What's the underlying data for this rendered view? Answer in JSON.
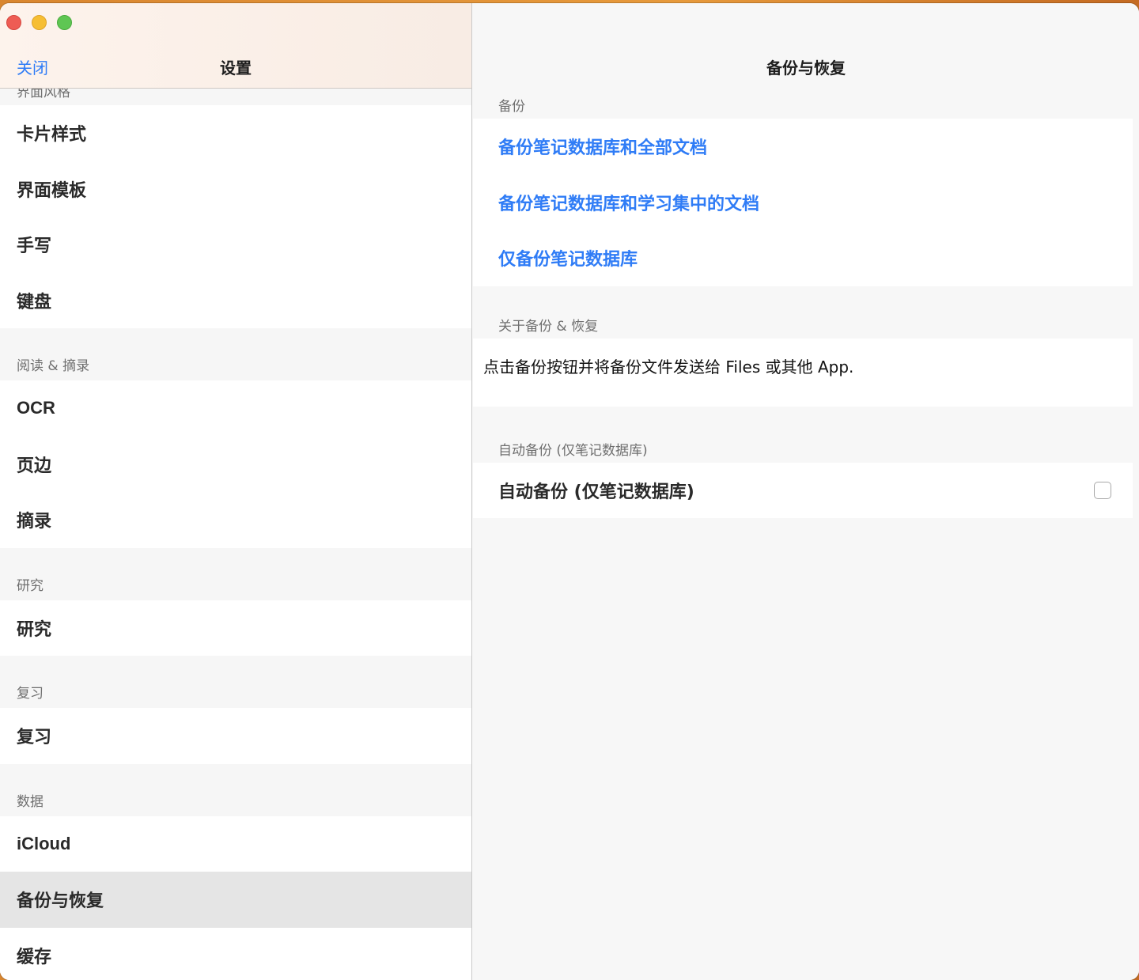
{
  "sidebar": {
    "close_label": "关闭",
    "title": "设置",
    "sections": [
      {
        "label": "界面风格",
        "items": [
          "卡片样式",
          "界面模板",
          "手写",
          "键盘"
        ]
      },
      {
        "label": "阅读 & 摘录",
        "items": [
          "OCR",
          "页边",
          "摘录"
        ]
      },
      {
        "label": "研究",
        "items": [
          "研究"
        ]
      },
      {
        "label": "复习",
        "items": [
          "复习"
        ]
      },
      {
        "label": "数据",
        "items": [
          "iCloud",
          "备份与恢复",
          "缓存"
        ]
      }
    ],
    "selected_item": "备份与恢复"
  },
  "detail": {
    "title": "备份与恢复",
    "backup_section_label": "备份",
    "actions": [
      "备份笔记数据库和全部文档",
      "备份笔记数据库和学习集中的文档",
      "仅备份笔记数据库"
    ],
    "about_section_label": "关于备份 & 恢复",
    "about_text": "点击备份按钮并将备份文件发送给 Files 或其他 App.",
    "auto_section_label": "自动备份 (仅笔记数据库)",
    "auto_toggle_label": "自动备份 (仅笔记数据库)",
    "auto_enabled": false
  }
}
